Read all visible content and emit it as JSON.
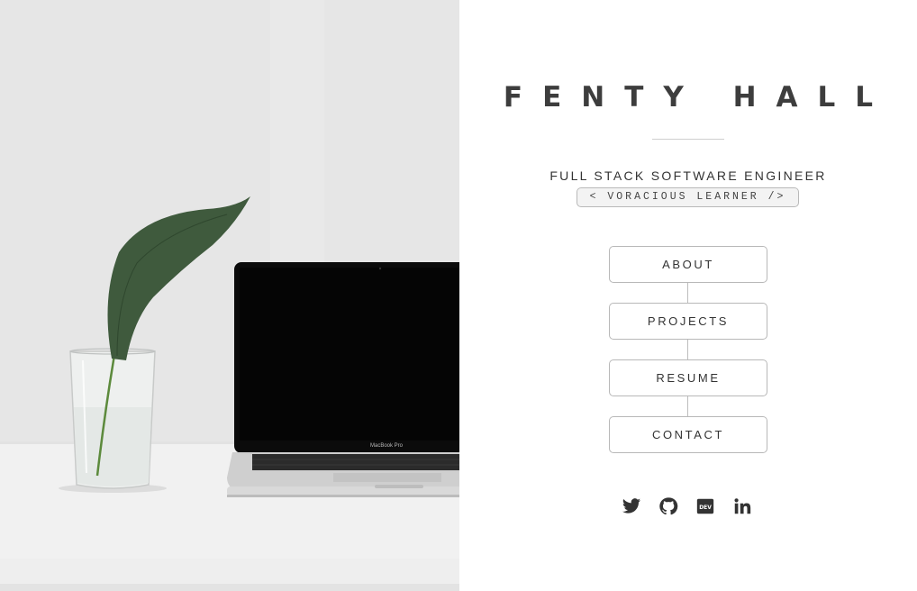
{
  "profile": {
    "name": "FENTY HALL",
    "role": "FULL STACK SOFTWARE ENGINEER",
    "tagline": "< VORACIOUS LEARNER />"
  },
  "nav": {
    "about": "ABOUT",
    "projects": "PROJECTS",
    "resume": "RESUME",
    "contact": "CONTACT"
  },
  "photo": {
    "laptop_label": "MacBook Pro"
  },
  "social": [
    "twitter-icon",
    "github-icon",
    "dev-icon",
    "linkedin-icon"
  ],
  "colors": {
    "text": "#3d3d3d",
    "border": "#b8b8b8",
    "icon": "#333333"
  }
}
